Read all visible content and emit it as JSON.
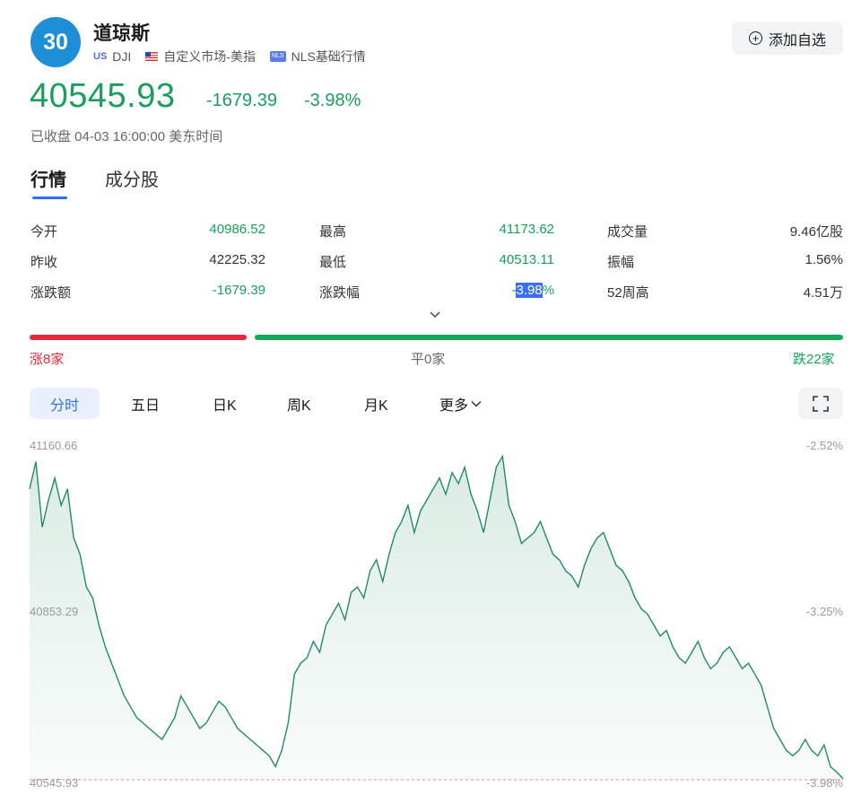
{
  "header": {
    "logo_text": "30",
    "title": "道琼斯",
    "market_tag": "US",
    "ticker": "DJI",
    "custom_market": "自定义市场-美指",
    "nls_tag": "NLS",
    "data_source": "NLS基础行情",
    "add_watchlist": "添加自选"
  },
  "quote": {
    "price": "40545.93",
    "change": "-1679.39",
    "change_pct": "-3.98%",
    "status": "已收盘 04-03 16:00:00 美东时间"
  },
  "tabs": [
    "行情",
    "成分股"
  ],
  "stats": [
    {
      "label": "今开",
      "value": "40986.52",
      "color": "green"
    },
    {
      "label": "最高",
      "value": "41173.62",
      "color": "green"
    },
    {
      "label": "成交量",
      "value": "9.46亿股",
      "color": "black"
    },
    {
      "label": "昨收",
      "value": "42225.32",
      "color": "black"
    },
    {
      "label": "最低",
      "value": "40513.11",
      "color": "green"
    },
    {
      "label": "振幅",
      "value": "1.56%",
      "color": "black"
    },
    {
      "label": "涨跌额",
      "value": "-1679.39",
      "color": "green"
    },
    {
      "label": "涨跌幅",
      "value": "-3.98%",
      "color": "green"
    },
    {
      "label": "52周高",
      "value": "4.51万",
      "color": "black"
    }
  ],
  "breadth": {
    "up": "涨8家",
    "flat": "平0家",
    "down": "跌22家",
    "up_count": 8,
    "flat_count": 0,
    "down_count": 22
  },
  "period_tabs": [
    "分时",
    "五日",
    "日K",
    "周K",
    "月K",
    "更多"
  ],
  "active_period": "分时",
  "colors": {
    "up": "#e8283d",
    "down": "#13a85c",
    "accent": "#2d6ff0",
    "line": "#1f8a6c"
  },
  "chart_data": {
    "type": "line",
    "title": "",
    "y_left_ticks": [
      "41160.66",
      "40853.29",
      "40545.93"
    ],
    "y_right_ticks": [
      "-2.52%",
      "-3.25%",
      "-3.98%"
    ],
    "ylim": [
      40545.93,
      41160.66
    ],
    "reference": 40545.93,
    "x_index": "minutes since open (09:30–16:00), sampled",
    "values": [
      41080,
      41130,
      41010,
      41060,
      41100,
      41050,
      41080,
      40990,
      40960,
      40900,
      40880,
      40830,
      40790,
      40760,
      40730,
      40700,
      40680,
      40660,
      40650,
      40640,
      40630,
      40620,
      40640,
      40660,
      40700,
      40680,
      40660,
      40640,
      40650,
      40670,
      40690,
      40680,
      40660,
      40640,
      40630,
      40620,
      40610,
      40600,
      40590,
      40570,
      40600,
      40650,
      40740,
      40760,
      40770,
      40800,
      40780,
      40830,
      40850,
      40870,
      40840,
      40890,
      40900,
      40880,
      40930,
      40950,
      40910,
      40960,
      41000,
      41020,
      41050,
      41000,
      41040,
      41060,
      41080,
      41100,
      41070,
      41110,
      41090,
      41120,
      41070,
      41040,
      41000,
      41060,
      41120,
      41140,
      41050,
      41020,
      40980,
      40990,
      41000,
      41020,
      40990,
      40960,
      40950,
      40930,
      40920,
      40900,
      40940,
      40970,
      40990,
      41000,
      40970,
      40940,
      40930,
      40910,
      40880,
      40860,
      40850,
      40830,
      40810,
      40820,
      40790,
      40770,
      40760,
      40780,
      40800,
      40770,
      40750,
      40760,
      40780,
      40790,
      40770,
      40750,
      40760,
      40740,
      40720,
      40680,
      40640,
      40620,
      40600,
      40590,
      40600,
      40620,
      40600,
      40590,
      40610,
      40570,
      40560,
      40548
    ]
  }
}
